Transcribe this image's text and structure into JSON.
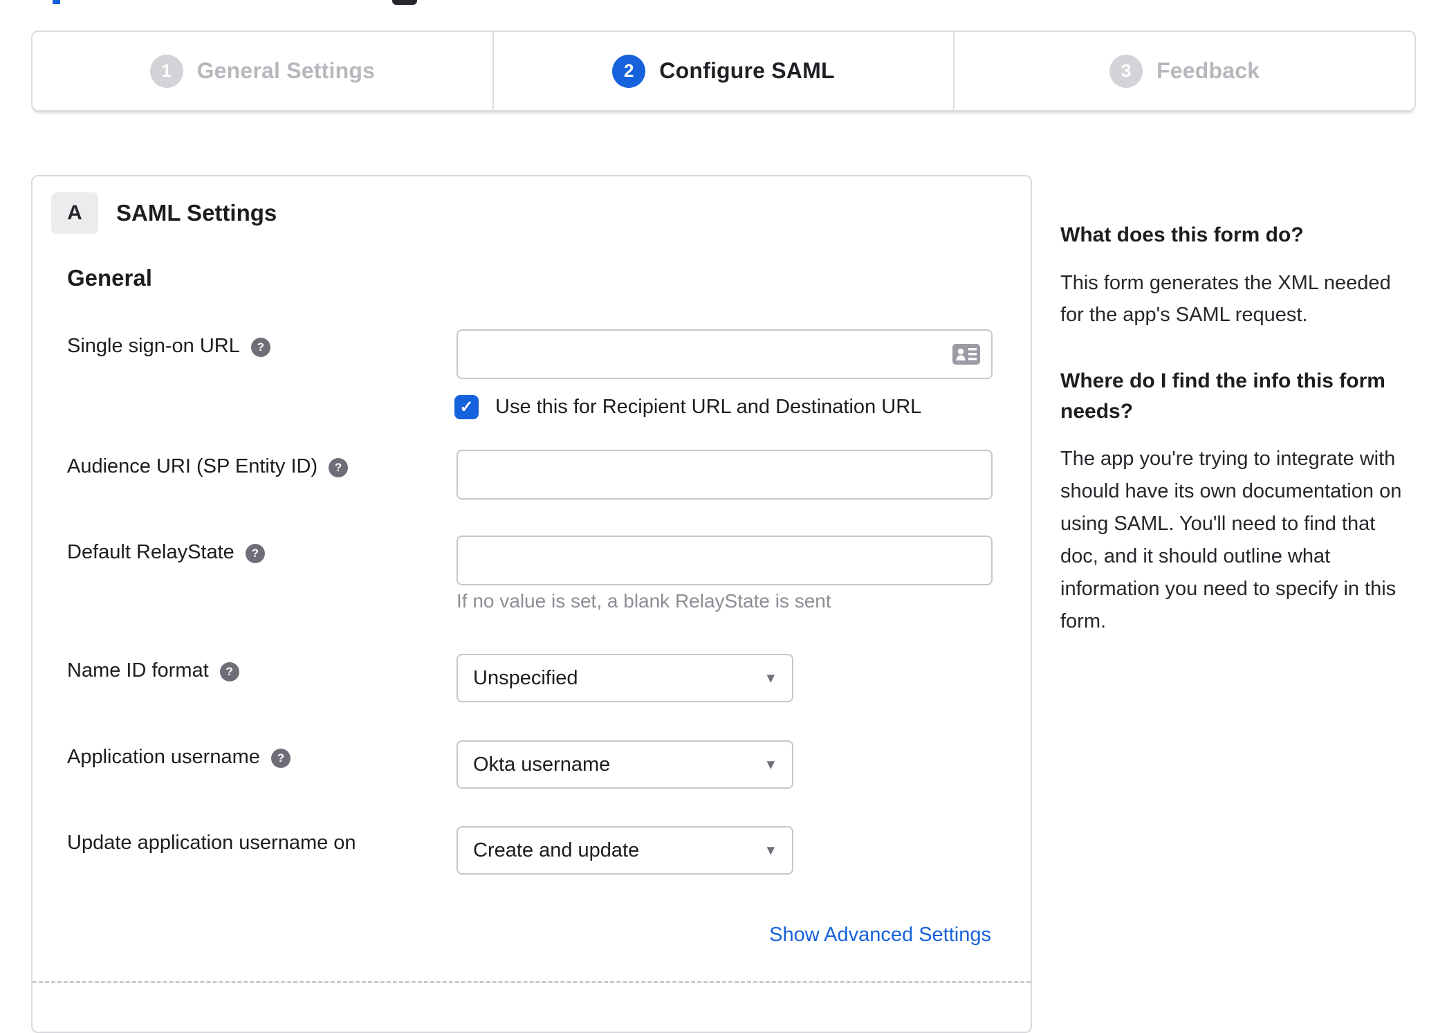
{
  "icons": {
    "help_glyph": "?",
    "check_glyph": "✓",
    "caret_glyph": "▾"
  },
  "colors": {
    "accent_blue": "#1662dd",
    "link_blue": "#1662dd",
    "inactive_gray": "#d3d3d8",
    "text_dark": "#1d1d21",
    "muted_gray": "#8d8d95"
  },
  "stepper": {
    "steps": [
      {
        "number": "1",
        "label": "General Settings",
        "active": false
      },
      {
        "number": "2",
        "label": "Configure SAML",
        "active": true
      },
      {
        "number": "3",
        "label": "Feedback",
        "active": false
      }
    ]
  },
  "panel": {
    "section_badge": "A",
    "section_title": "SAML Settings",
    "group_title": "General",
    "fields": {
      "sso_url": {
        "label": "Single sign-on URL",
        "value": "",
        "checkbox_checked": true,
        "checkbox_label": "Use this for Recipient URL and Destination URL"
      },
      "audience_uri": {
        "label": "Audience URI (SP Entity ID)",
        "value": ""
      },
      "relay_state": {
        "label": "Default RelayState",
        "value": "",
        "helper": "If no value is set, a blank RelayState is sent"
      },
      "name_id_format": {
        "label": "Name ID format",
        "value": "Unspecified"
      },
      "app_username": {
        "label": "Application username",
        "value": "Okta username"
      },
      "update_username_on": {
        "label": "Update application username on",
        "value": "Create and update"
      }
    },
    "advanced_link": "Show Advanced Settings"
  },
  "sidebar": {
    "sections": [
      {
        "heading": "What does this form do?",
        "body": "This form generates the XML needed\nfor the app's SAML request."
      },
      {
        "heading": "Where do I find the info this form\nneeds?",
        "body": "The app you're trying to integrate with\nshould have its own documentation on\nusing SAML. You'll need to find that\ndoc, and it should outline what\ninformation you need to specify in this\nform."
      }
    ]
  }
}
